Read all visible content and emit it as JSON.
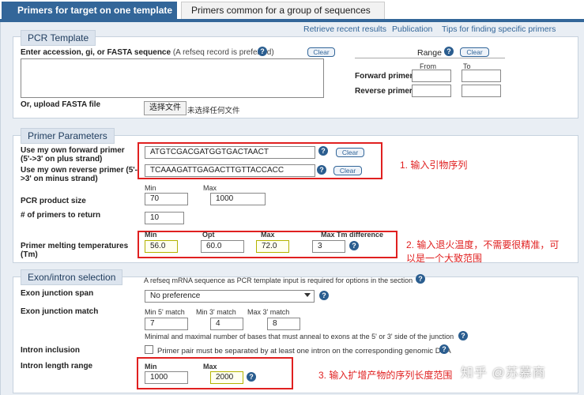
{
  "tabs": {
    "active": "Primers for target on one template",
    "inactive": "Primers common for a group of sequences"
  },
  "links": [
    "Retrieve recent results",
    "Publication",
    "Tips for finding specific primers"
  ],
  "pcr_template": {
    "legend": "PCR Template",
    "accession_label": "Enter accession, gi, or FASTA sequence",
    "accession_note": "(A refseq record is preferred)",
    "clear": "Clear",
    "upload_label": "Or, upload FASTA file",
    "file_button": "选择文件",
    "file_status": "未选择任何文件",
    "range_label": "Range",
    "range_clear": "Clear",
    "from_label": "From",
    "to_label": "To",
    "forward_primer_label": "Forward primer",
    "reverse_primer_label": "Reverse primer"
  },
  "primer_params": {
    "legend": "Primer Parameters",
    "fwd_label_line1": "Use my own forward primer",
    "fwd_label_line2": "(5'->3' on plus strand)",
    "fwd_value": "ATGTCGACGATGGTGACTAACT",
    "rev_label_line1": "Use my own reverse primer (5'-",
    "rev_label_line2": ">3' on minus strand)",
    "rev_value": "TCAAAGATTGAGACTTGTTACCACC",
    "clear": "Clear",
    "min_label": "Min",
    "max_label": "Max",
    "product_size_label": "PCR product size",
    "product_min": "70",
    "product_max": "1000",
    "num_primers_label": "# of primers to return",
    "num_primers": "10",
    "tm_label": "Primer melting temperatures",
    "tm_sub": "(Tm)",
    "tm_min_label": "Min",
    "tm_opt_label": "Opt",
    "tm_max_label": "Max",
    "tm_diff_label": "Max Tm difference",
    "tm_min": "56.0",
    "tm_opt": "60.0",
    "tm_max": "72.0",
    "tm_diff": "3"
  },
  "exon_intron": {
    "legend": "Exon/intron selection",
    "note": "A refseq mRNA sequence as PCR template input is required for options in the section",
    "junction_span_label": "Exon junction span",
    "junction_span_value": "No preference",
    "junction_match_label": "Exon junction match",
    "min5_label": "Min 5' match",
    "min3_label": "Min 3' match",
    "max3_label": "Max 3' match",
    "min5": "7",
    "min3": "4",
    "max3": "8",
    "match_hint": "Minimal and maximal number of bases that must anneal to exons at the 5' or 3' side of the junction",
    "intron_inclusion_label": "Intron inclusion",
    "intron_inclusion_text": "Primer pair must be separated by at least one intron on the corresponding genomic DNA",
    "intron_length_label": "Intron length range",
    "min_label": "Min",
    "max_label": "Max",
    "intron_min": "1000",
    "intron_max": "2000"
  },
  "annotations": {
    "a1": "1. 输入引物序列",
    "a2_line1": "2. 输入退火温度，不需要很精准，可",
    "a2_line2": "以是一个大致范围",
    "a3": "3. 输入扩增产物的序列长度范围"
  },
  "watermark": "知乎 @苏慕商",
  "colors": {
    "tab_active": "#336699",
    "annotation": "#e02020",
    "panel_bg": "#e9eef4"
  }
}
